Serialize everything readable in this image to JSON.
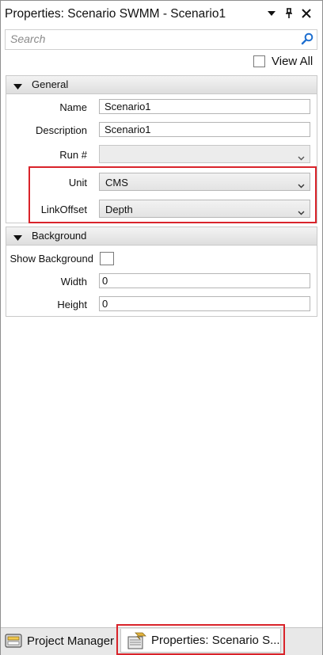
{
  "window": {
    "title": "Properties: Scenario SWMM - Scenario1",
    "icons": [
      "dropdown-arrow-icon",
      "pin-icon",
      "close-icon"
    ]
  },
  "search": {
    "placeholder": "Search",
    "value": ""
  },
  "view_all": {
    "label": "View All",
    "checked": false
  },
  "sections": {
    "general": {
      "title": "General",
      "rows": {
        "name": {
          "label": "Name",
          "value": "Scenario1"
        },
        "description": {
          "label": "Description",
          "value": "Scenario1"
        },
        "run": {
          "label": "Run #",
          "value": ""
        },
        "unit": {
          "label": "Unit",
          "value": "CMS"
        },
        "linkoffset": {
          "label": "LinkOffset",
          "value": "Depth"
        }
      }
    },
    "background": {
      "title": "Background",
      "rows": {
        "show_background": {
          "label": "Show Background",
          "checked": false
        },
        "width": {
          "label": "Width",
          "value": "0"
        },
        "height": {
          "label": "Height",
          "value": "0"
        }
      }
    }
  },
  "tabs": [
    {
      "label": "Project Manager",
      "active": false
    },
    {
      "label": "Properties: Scenario S...",
      "active": true
    }
  ],
  "colors": {
    "highlight": "#d9232a",
    "accent_icon": "#1e6fd0"
  }
}
